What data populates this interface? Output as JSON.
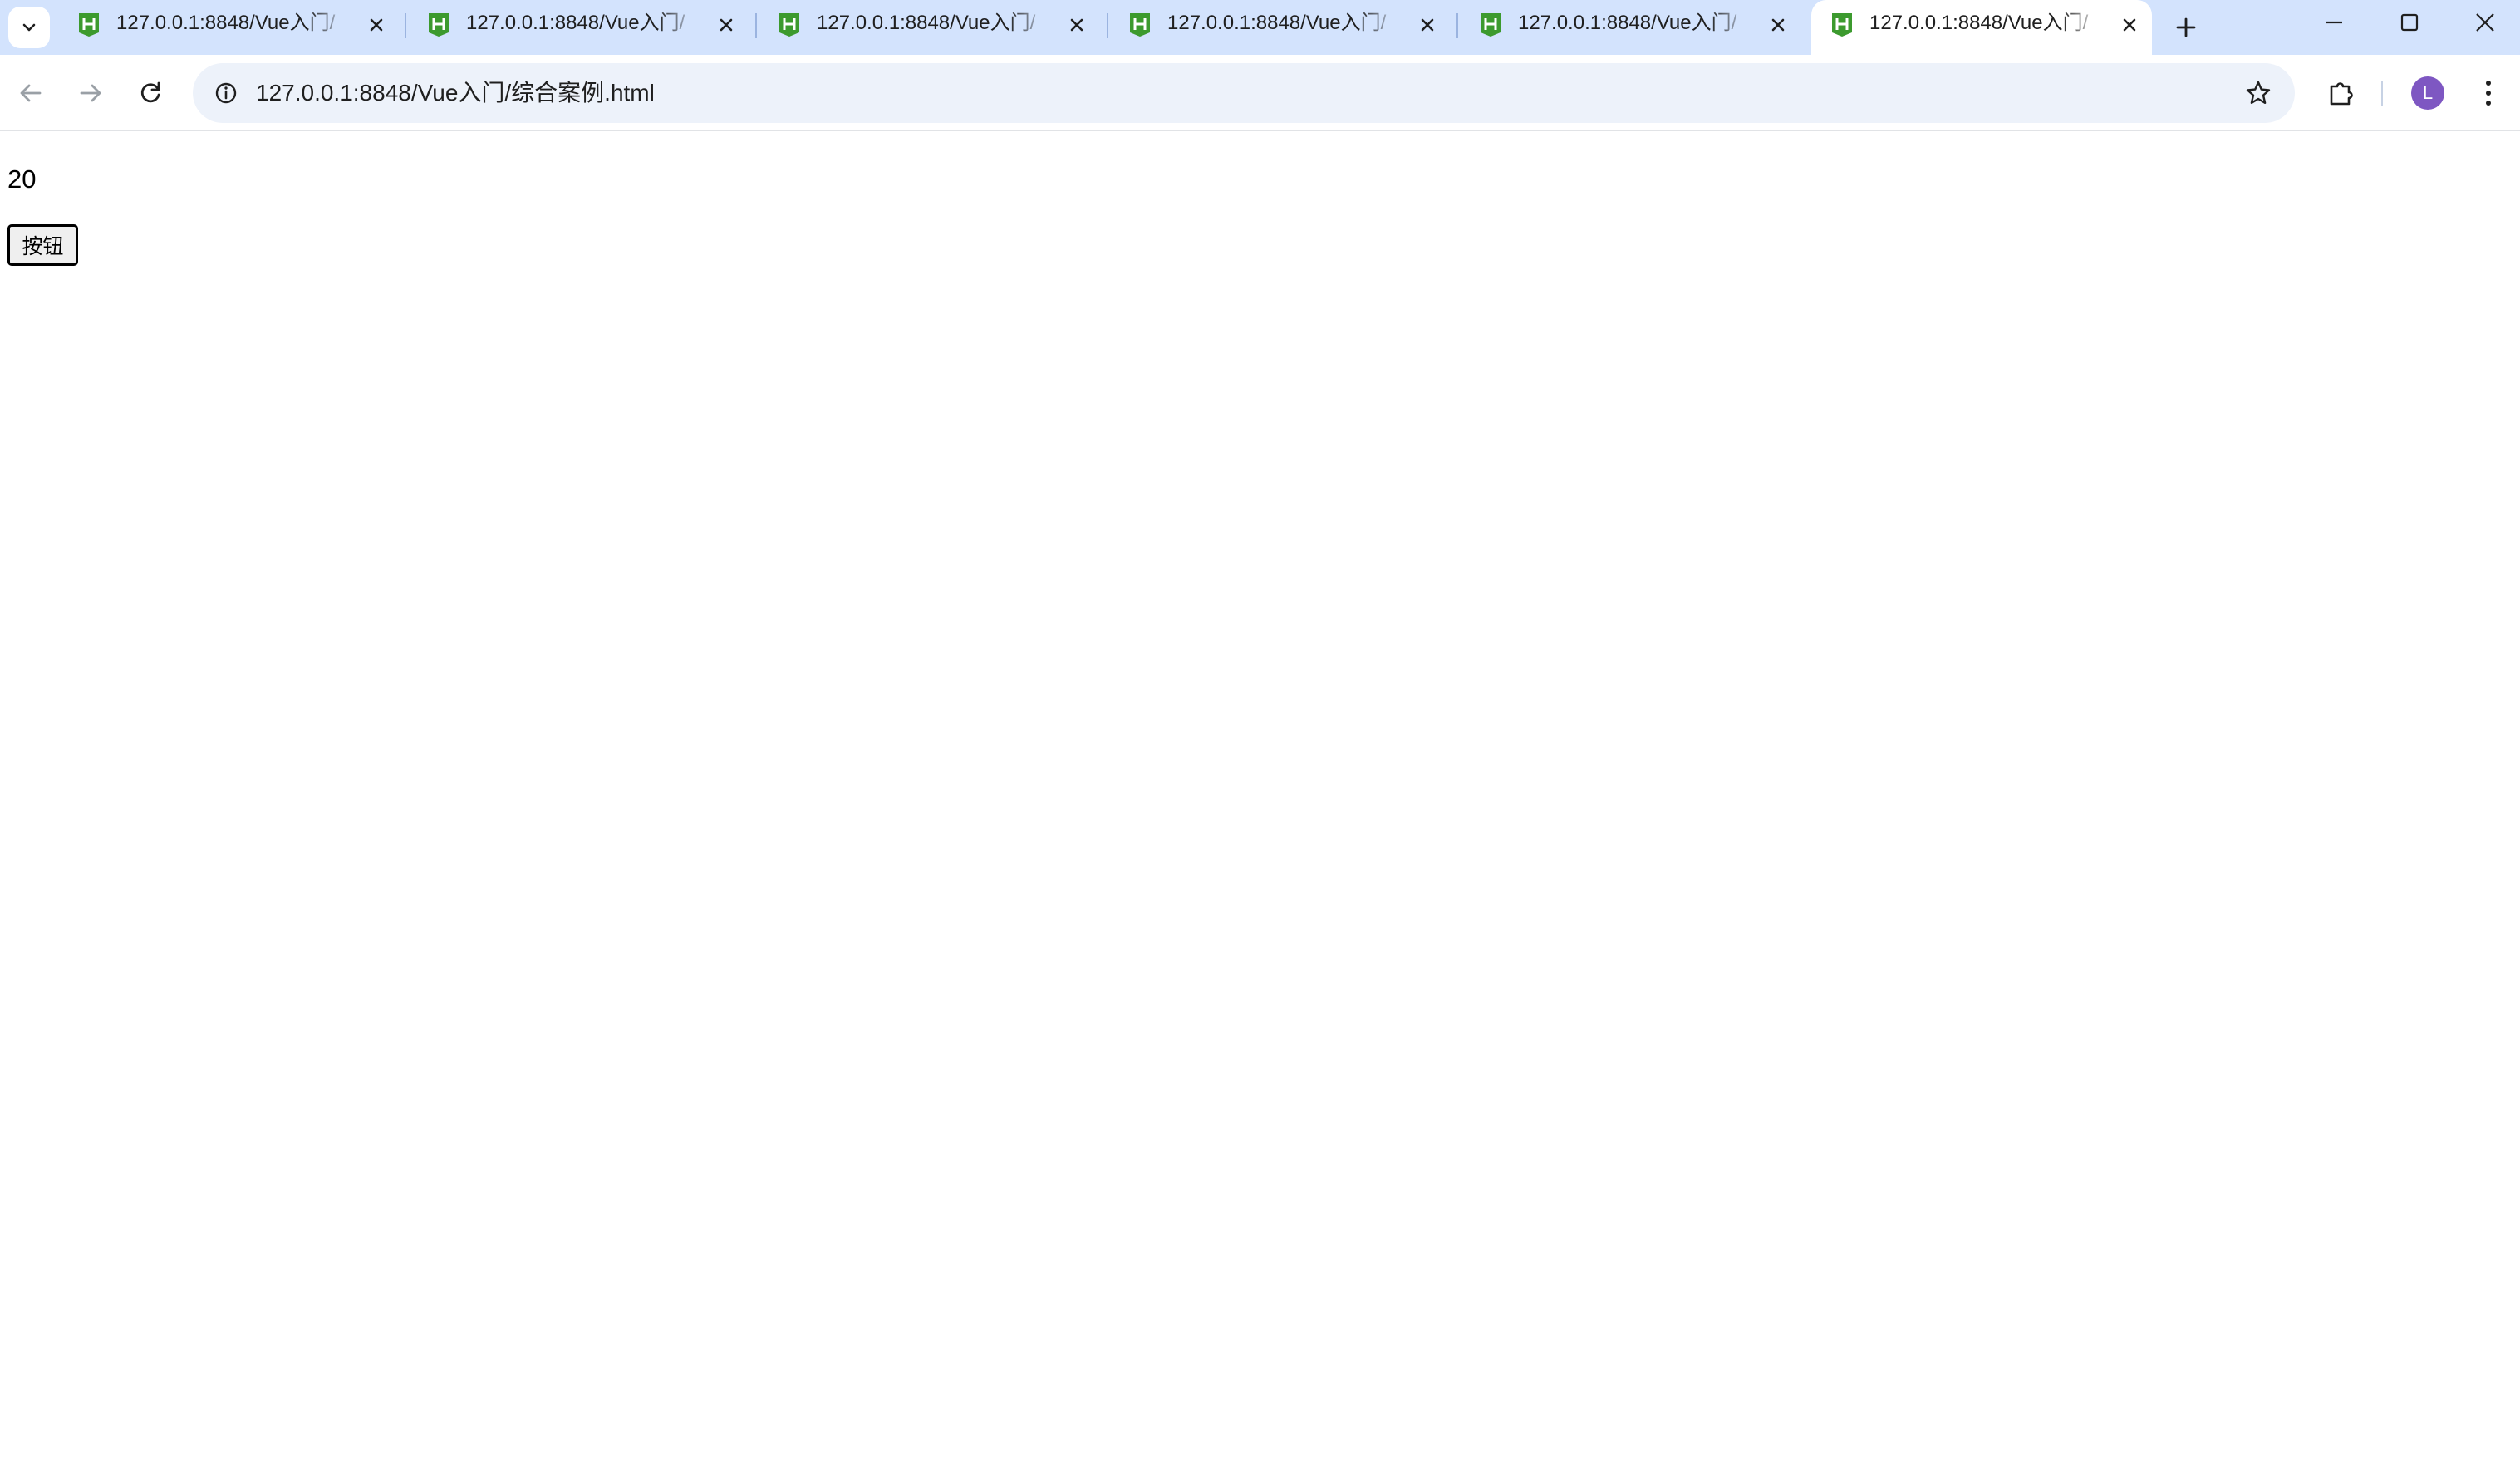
{
  "browser": {
    "tabs": [
      {
        "title": "127.0.0.1:8848/Vue入门/",
        "active": false
      },
      {
        "title": "127.0.0.1:8848/Vue入门/",
        "active": false
      },
      {
        "title": "127.0.0.1:8848/Vue入门/",
        "active": false
      },
      {
        "title": "127.0.0.1:8848/Vue入门/",
        "active": false
      },
      {
        "title": "127.0.0.1:8848/Vue入门/",
        "active": false
      },
      {
        "title": "127.0.0.1:8848/Vue入门/",
        "active": true
      }
    ],
    "address_bar": {
      "url": "127.0.0.1:8848/Vue入门/综合案例.html"
    },
    "profile_initial": "L",
    "colors": {
      "tabstrip_bg": "#d3e3fd",
      "omnibox_bg": "#edf2fa",
      "favicon": "#3c9a2e",
      "avatar": "#7e57c2"
    },
    "icons": {
      "tab_dropdown": "chevron-down-icon",
      "favicon": "hbuilder-icon",
      "tab_close": "close-icon",
      "new_tab": "plus-icon",
      "minimize": "minimize-icon",
      "maximize": "maximize-icon",
      "close_window": "close-icon",
      "back": "arrow-left-icon",
      "forward": "arrow-right-icon",
      "reload": "reload-icon",
      "site_info": "info-icon",
      "bookmark": "star-icon",
      "extensions": "puzzle-icon",
      "menu": "kebab-menu-icon"
    }
  },
  "page": {
    "counter_value": "20",
    "button_label": "按钮"
  }
}
